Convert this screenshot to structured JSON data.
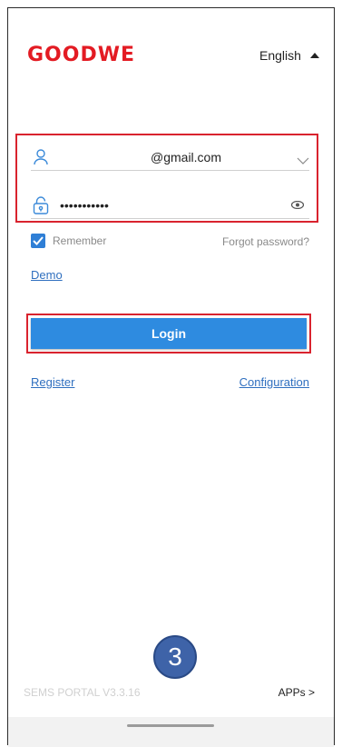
{
  "brand": {
    "logo_text": "GOODWE",
    "color": "#e31b23"
  },
  "language": {
    "label": "English",
    "icon": "caret-up-icon"
  },
  "login_form": {
    "email_value": "@gmail.com",
    "password_value": "•••••••••••",
    "remember_label": "Remember",
    "remember_checked": true,
    "forgot_label": "Forgot password?",
    "demo_label": "Demo",
    "login_label": "Login",
    "register_label": "Register",
    "configuration_label": "Configuration"
  },
  "annotation": {
    "step_number": "3"
  },
  "footer": {
    "version": "SEMS PORTAL  V3.3.16",
    "apps_label": "APPs  >"
  },
  "colors": {
    "accent": "#2e8be0",
    "highlight": "#d9232e",
    "link": "#2f6fbf"
  }
}
